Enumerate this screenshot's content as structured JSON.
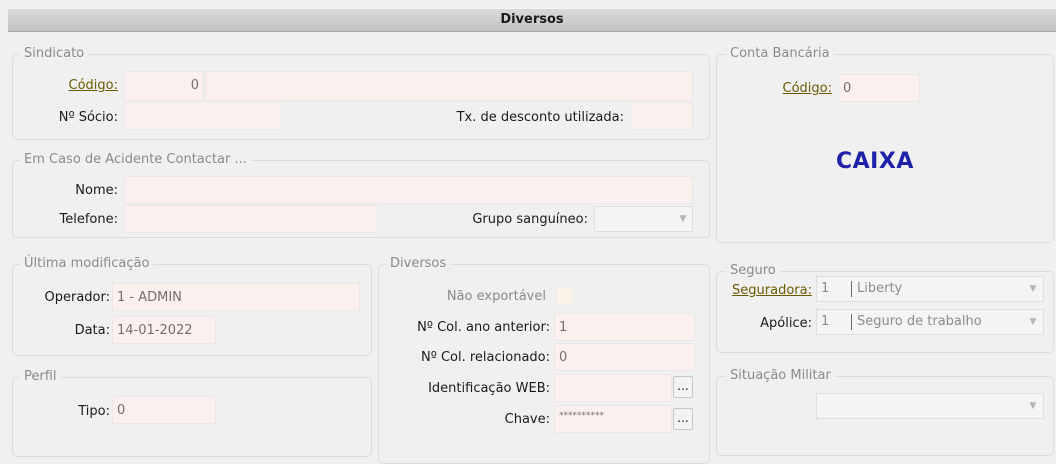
{
  "title": "Diversos",
  "sindicato": {
    "legend": "Sindicato",
    "codigo_label": "Código:",
    "codigo_value": "0",
    "codigo_desc": "",
    "socio_label": "Nº Sócio:",
    "socio_value": "",
    "desconto_label": "Tx. de desconto utilizada:",
    "desconto_value": ""
  },
  "conta": {
    "legend": "Conta Bancária",
    "codigo_label": "Código:",
    "codigo_value": "0",
    "bank_name": "CAIXA"
  },
  "acidente": {
    "legend": "Em Caso de Acidente Contactar ...",
    "nome_label": "Nome:",
    "nome_value": "",
    "telefone_label": "Telefone:",
    "telefone_value": "",
    "grupo_label": "Grupo sanguíneo:",
    "grupo_value": ""
  },
  "modificacao": {
    "legend": "Última modificação",
    "operador_label": "Operador:",
    "operador_value": "1 - ADMIN",
    "data_label": "Data:",
    "data_value": "14-01-2022"
  },
  "diversos": {
    "legend": "Diversos",
    "nao_exportavel_label": "Não exportável",
    "col_anterior_label": "Nº Col. ano anterior:",
    "col_anterior_value": "1",
    "col_relacionado_label": "Nº Col. relacionado:",
    "col_relacionado_value": "0",
    "web_label": "Identificação WEB:",
    "web_value": "",
    "chave_label": "Chave:",
    "chave_value": "**********",
    "dots_label": "..."
  },
  "seguro": {
    "legend": "Seguro",
    "seguradora_label": "Seguradora:",
    "seguradora_code": "1",
    "seguradora_value": "Liberty",
    "apolice_label": "Apólice:",
    "apolice_code": "1",
    "apolice_value": "Seguro de trabalho"
  },
  "perfil": {
    "legend": "Perfil",
    "tipo_label": "Tipo:",
    "tipo_value": "0"
  },
  "militar": {
    "legend": "Situação Militar",
    "value": ""
  },
  "icons": {
    "dropdown": "chevron-down-icon"
  }
}
